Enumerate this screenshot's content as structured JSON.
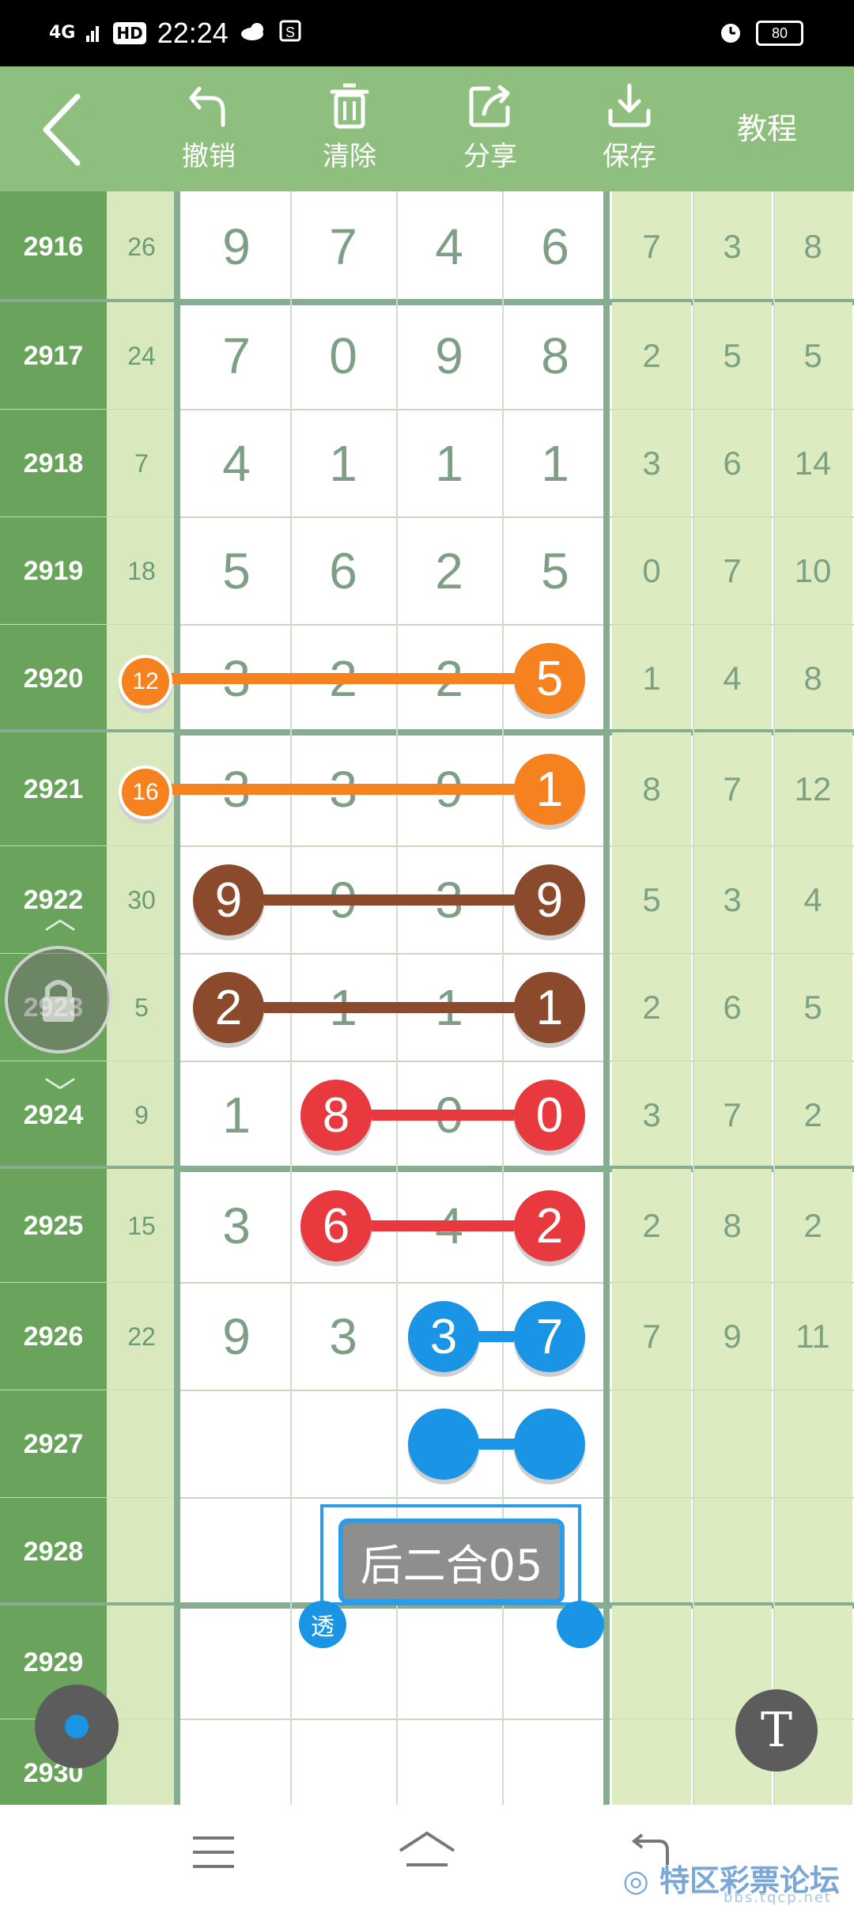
{
  "status_bar": {
    "signal": "4G",
    "hd": "HD",
    "time": "22:24",
    "battery": "80"
  },
  "toolbar": {
    "undo": "撤销",
    "clear": "清除",
    "share": "分享",
    "save": "保存",
    "tutorial": "教程"
  },
  "rows": [
    {
      "period": "2916",
      "sum": "26",
      "d": [
        "9",
        "7",
        "4",
        "6"
      ],
      "s": [
        "7",
        "3",
        "8"
      ]
    },
    {
      "period": "2917",
      "sum": "24",
      "d": [
        "7",
        "0",
        "9",
        "8"
      ],
      "s": [
        "2",
        "5",
        "5"
      ]
    },
    {
      "period": "2918",
      "sum": "7",
      "d": [
        "4",
        "1",
        "1",
        "1"
      ],
      "s": [
        "3",
        "6",
        "14"
      ]
    },
    {
      "period": "2919",
      "sum": "18",
      "d": [
        "5",
        "6",
        "2",
        "5"
      ],
      "s": [
        "0",
        "7",
        "10"
      ]
    },
    {
      "period": "2920",
      "sum": "12",
      "d": [
        "3",
        "2",
        "2",
        "5"
      ],
      "s": [
        "1",
        "4",
        "8"
      ]
    },
    {
      "period": "2921",
      "sum": "16",
      "d": [
        "3",
        "3",
        "9",
        "1"
      ],
      "s": [
        "8",
        "7",
        "12"
      ]
    },
    {
      "period": "2922",
      "sum": "30",
      "d": [
        "9",
        "9",
        "3",
        "9"
      ],
      "s": [
        "5",
        "3",
        "4"
      ]
    },
    {
      "period": "2923",
      "sum": "5",
      "d": [
        "2",
        "1",
        "1",
        "1"
      ],
      "s": [
        "2",
        "6",
        "5"
      ]
    },
    {
      "period": "2924",
      "sum": "9",
      "d": [
        "1",
        "8",
        "0",
        "0"
      ],
      "s": [
        "3",
        "7",
        "2"
      ]
    },
    {
      "period": "2925",
      "sum": "15",
      "d": [
        "3",
        "6",
        "4",
        "2"
      ],
      "s": [
        "2",
        "8",
        "2"
      ]
    },
    {
      "period": "2926",
      "sum": "22",
      "d": [
        "9",
        "3",
        "3",
        "7"
      ],
      "s": [
        "7",
        "9",
        "11"
      ]
    },
    {
      "period": "2927",
      "sum": "",
      "d": [
        "",
        "",
        "",
        ""
      ],
      "s": [
        "",
        "",
        ""
      ]
    },
    {
      "period": "2928",
      "sum": "",
      "d": [
        "",
        "",
        "",
        ""
      ],
      "s": [
        "",
        "",
        ""
      ]
    },
    {
      "period": "2929",
      "sum": "",
      "d": [
        "",
        "",
        "",
        ""
      ],
      "s": [
        "",
        "",
        ""
      ]
    },
    {
      "period": "2930",
      "sum": "",
      "d": [
        "",
        "",
        "",
        ""
      ],
      "s": [
        "",
        "",
        ""
      ]
    }
  ],
  "annotation": {
    "label": "后二合05",
    "handle_text": "透"
  },
  "colors": {
    "orange": "#f5821f",
    "brown": "#8b4a2b",
    "red": "#e8393f",
    "blue": "#1a95e6"
  },
  "watermark": {
    "title": "特区彩票论坛",
    "url": "bbs.tqcp.net"
  }
}
